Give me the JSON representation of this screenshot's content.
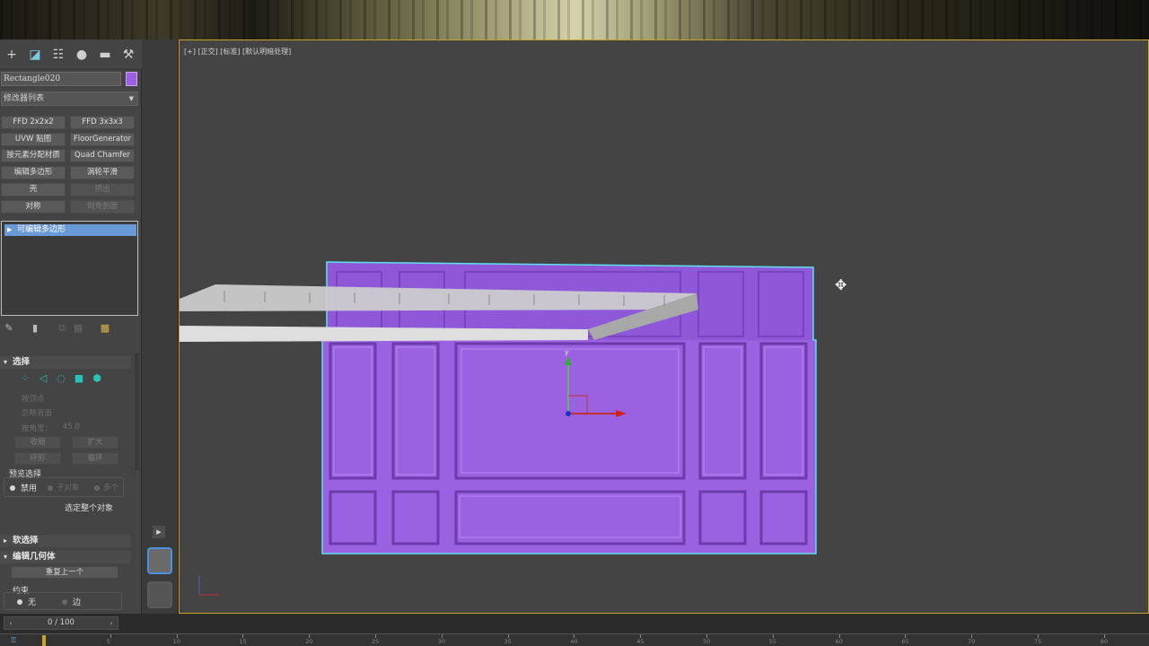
{
  "toolbar": {
    "tabs": [
      {
        "name": "create-tab",
        "icon": "plus-icon",
        "glyph": "+"
      },
      {
        "name": "modify-tab",
        "icon": "modify-icon",
        "glyph": "◪"
      },
      {
        "name": "hierarchy-tab",
        "icon": "hierarchy-icon",
        "glyph": "☷"
      },
      {
        "name": "motion-tab",
        "icon": "motion-icon",
        "glyph": "●"
      },
      {
        "name": "display-tab",
        "icon": "display-icon",
        "glyph": "▬"
      },
      {
        "name": "utilities-tab",
        "icon": "wrench-icon",
        "glyph": "⚒"
      }
    ]
  },
  "object": {
    "name": "Rectangle020",
    "color": "#9a62e0"
  },
  "modifier_list": {
    "label": "修改器列表"
  },
  "modifier_buttons": [
    {
      "label": "FFD 2x2x2",
      "enabled": true
    },
    {
      "label": "FFD 3x3x3",
      "enabled": true
    },
    {
      "label": "UVW 贴图",
      "enabled": true
    },
    {
      "label": "FloorGenerator",
      "enabled": true
    },
    {
      "label": "按元素分配材质",
      "enabled": true
    },
    {
      "label": "Quad Chamfer",
      "enabled": true
    },
    {
      "label": "编辑多边形",
      "enabled": true
    },
    {
      "label": "涡轮平滑",
      "enabled": true
    },
    {
      "label": "壳",
      "enabled": true
    },
    {
      "label": "挤出",
      "enabled": false
    },
    {
      "label": "对称",
      "enabled": true
    },
    {
      "label": "倒角剖面",
      "enabled": false
    }
  ],
  "stack": {
    "items": [
      "可编辑多边形"
    ]
  },
  "selection": {
    "header": "选择",
    "by_vertex": "按顶点",
    "ignore_backface": "忽略背面",
    "by_angle": "按角度：",
    "angle_value": "45.0",
    "shrink": "收缩",
    "grow": "扩大",
    "ring": "环形",
    "loop": "循环",
    "preview_label": "预览选择",
    "preview_off": "禁用",
    "preview_subobject": "子对象",
    "preview_multi": "多个",
    "select_whole": "选定整个对象"
  },
  "soft_selection": {
    "header": "软选择"
  },
  "edit_geometry": {
    "header": "编辑几何体",
    "repeat_last": "重复上一个",
    "constraints": "约束",
    "none": "无",
    "edge": "边"
  },
  "viewport": {
    "label": "[+] [正交] [标准] [默认明暗处理]"
  },
  "timeline": {
    "frame": "0 / 100",
    "ticks": [
      "5",
      "10",
      "15",
      "20",
      "25",
      "30",
      "35",
      "40",
      "45",
      "50",
      "55",
      "60",
      "65",
      "70",
      "75",
      "80",
      "85",
      "90",
      "95"
    ]
  },
  "colors": {
    "object": "#9a62e0",
    "selection_edge": "#5ee0f0",
    "viewport_border": "#c9a227",
    "accent": "#6a9ad6"
  }
}
